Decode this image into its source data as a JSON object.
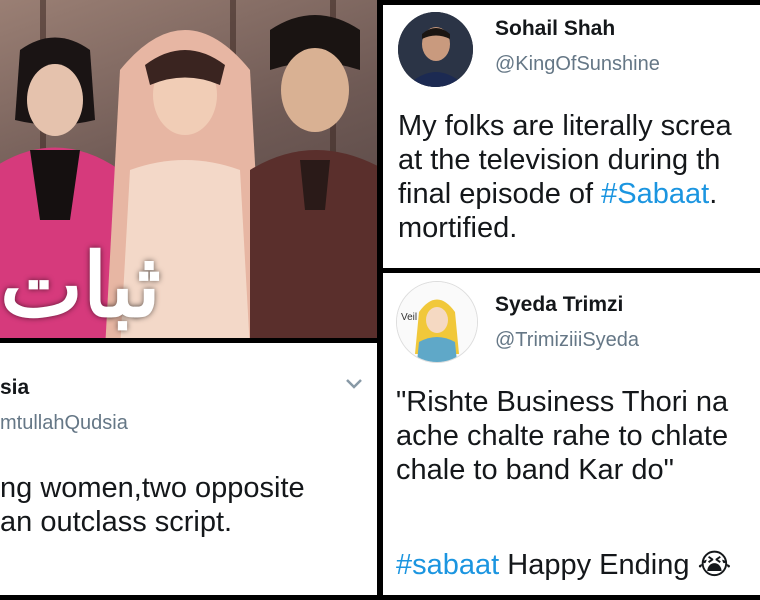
{
  "poster": {
    "title_logo": "ثبات"
  },
  "tweet_right_top": {
    "name": "Sohail Shah",
    "handle": "@KingOfSunshine",
    "lines": [
      "My folks are literally screa",
      "at the television during th",
      "final episode of ",
      "#Sabaat",
      ". ",
      "mortified."
    ]
  },
  "tweet_right_bottom": {
    "name": "Syeda Trimzi",
    "handle": "@TrimiziiiSyeda",
    "avatar_text": "Veil",
    "lines": [
      "\"Rishte Business Thori na",
      "ache chalte rahe to chlate",
      "chale to band Kar do\""
    ],
    "hashtag": "#sabaat",
    "hashtag_rest": " Happy Ending ",
    "emoji": "😭"
  },
  "tweet_left_bottom": {
    "name": "sia",
    "handle": "mtullahQudsia",
    "lines": [
      "ng women,two opposite",
      "an outclass script."
    ]
  },
  "colors": {
    "hashtag": "#1b95e0",
    "handle": "#657786",
    "text": "#14171a",
    "border": "#000000"
  }
}
